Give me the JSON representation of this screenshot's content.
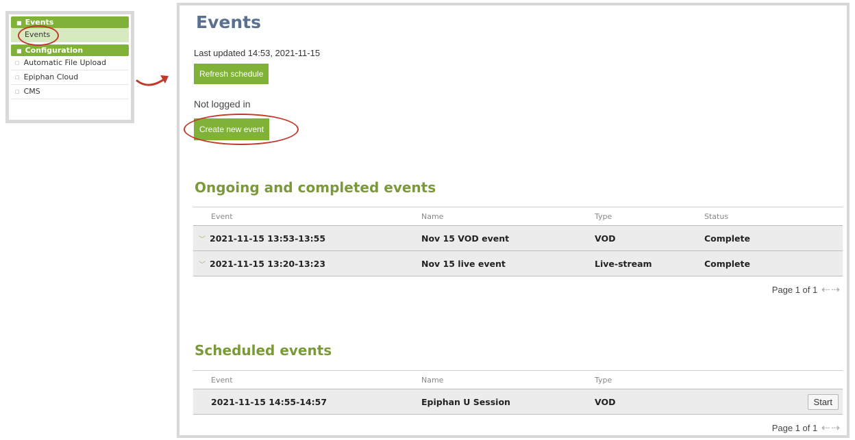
{
  "sidebar": {
    "events_header": "Events",
    "events_item": "Events",
    "config_header": "Configuration",
    "config_items": [
      "Automatic File Upload",
      "Epiphan Cloud",
      "CMS"
    ]
  },
  "page": {
    "title": "Events",
    "last_updated": "Last updated 14:53, 2021-11-15",
    "refresh_button": "Refresh schedule",
    "login_status": "Not logged in",
    "create_button": "Create new event"
  },
  "ongoing": {
    "title": "Ongoing and completed events",
    "columns": [
      "Event",
      "Name",
      "Type",
      "Status"
    ],
    "rows": [
      {
        "event": "2021-11-15 13:53-13:55",
        "name": "Nov 15 VOD event",
        "type": "VOD",
        "status": "Complete"
      },
      {
        "event": "2021-11-15 13:20-13:23",
        "name": "Nov 15 live event",
        "type": "Live-stream",
        "status": "Complete"
      }
    ],
    "pager": "Page 1 of 1"
  },
  "scheduled": {
    "title": "Scheduled events",
    "columns": [
      "Event",
      "Name",
      "Type"
    ],
    "rows": [
      {
        "event": "2021-11-15 14:55-14:57",
        "name": "Epiphan U Session",
        "type": "VOD",
        "action": "Start"
      }
    ],
    "pager": "Page 1 of 1"
  },
  "colors": {
    "accent_green": "#7fb236",
    "title_blue": "#5a7091",
    "section_green": "#7a9a3a",
    "annotation_red": "#c0392b"
  },
  "icons": {
    "bullet": "bullet-icon",
    "expand": "chevron-down-icon",
    "prev": "arrow-left-icon",
    "next": "arrow-right-icon",
    "callout": "curved-arrow-icon"
  }
}
